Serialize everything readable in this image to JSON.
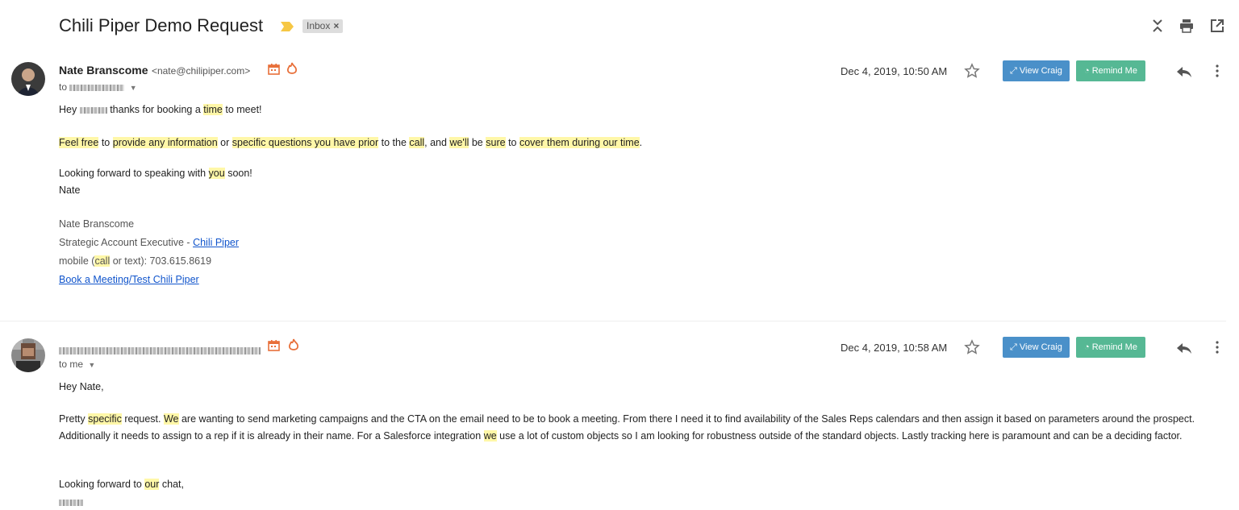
{
  "thread": {
    "subject": "Chili Piper Demo Request",
    "label_chip": "Inbox",
    "label_chip_close": "×",
    "icons": [
      "expand-collapse-icon",
      "print-icon",
      "open-new-window-icon"
    ]
  },
  "messages": [
    {
      "sender_name": "Nate Branscome",
      "sender_email": "<nate@chilipiper.com>",
      "to_prefix": "to",
      "date": "Dec 4, 2019, 10:50 AM",
      "view_button": "View Craig",
      "remind_button": "Remind Me",
      "greeting_a": "Hey",
      "greeting_b": "thanks for booking a",
      "greeting_c": "time",
      "greeting_d": "to meet!",
      "p1": {
        "s1": "Feel free",
        "s2": "to",
        "s3": "provide any information",
        "s4": "or",
        "s5": "specific questions you have prior",
        "s6": "to the",
        "s7": "call",
        "s8": ", and",
        "s9": "we'll",
        "s10": "be",
        "s11": "sure",
        "s12": "to",
        "s13": "cover them during our time",
        "s14": "."
      },
      "closing_a": "Looking forward to speaking with",
      "closing_b": "you",
      "closing_c": "soon!",
      "sign_name": "Nate",
      "signature": {
        "name": "Nate Branscome",
        "title_prefix": "Strategic Account Executive - ",
        "company_link": "Chili Piper",
        "mobile_a": "mobile (",
        "mobile_b": "call",
        "mobile_c": "or text): 703.615.8619",
        "booking_link": "Book a Meeting/Test Chili Piper"
      }
    },
    {
      "to_label": "to me",
      "date": "Dec 4, 2019, 10:58 AM",
      "view_button": "View Craig",
      "remind_button": "Remind Me",
      "greeting": "Hey Nate,",
      "p1": {
        "s1": "Pretty",
        "s2": "specific",
        "s3": "request.",
        "s4": "We",
        "s5": "are wanting to send marketing campaigns and the CTA on the email need to be to book a meeting. From there I need it to find availability of the Sales Reps calendars and then assign it based on parameters around the prospect. Additionally it needs to assign to a rep if it is already in their name. For a Salesforce integration",
        "s6": "we",
        "s7": "use a lot of custom objects so I am looking for robustness outside of the standard objects. Lastly tracking here is paramount and can be a deciding factor."
      },
      "closing_a": "Looking forward to",
      "closing_b": "our",
      "closing_c": "chat,"
    }
  ],
  "colors": {
    "view_button": "#4a90c9",
    "remind_button": "#56b894",
    "highlight": "#fff7a8",
    "link": "#1155cc",
    "calendar_icon": "#e8703a",
    "fire_icon": "#e8703a",
    "importance_marker": "#f6c744"
  }
}
